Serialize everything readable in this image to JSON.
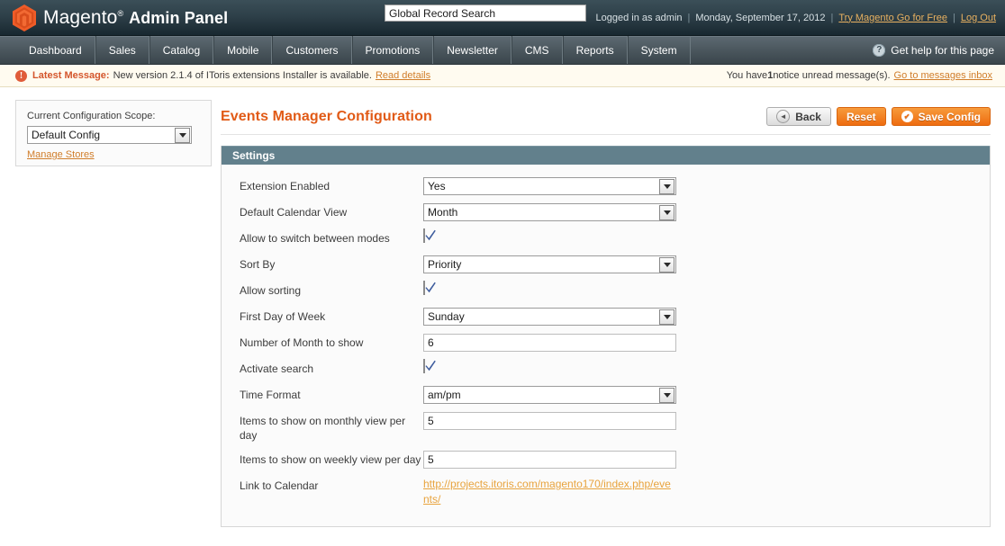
{
  "header": {
    "brand_name": "Magento",
    "brand_tm": "®",
    "brand_suffix": "Admin Panel",
    "search_value": "Global Record Search",
    "search_placeholder": "Global Record Search",
    "logged_in": "Logged in as admin",
    "date": "Monday, September 17, 2012",
    "try_link": "Try Magento Go for Free",
    "logout_link": "Log Out",
    "separator": "|",
    "logo_color": "#ef5c28"
  },
  "nav": {
    "items": [
      {
        "label": "Dashboard",
        "name": "nav-item-dashboard"
      },
      {
        "label": "Sales",
        "name": "nav-item-sales"
      },
      {
        "label": "Catalog",
        "name": "nav-item-catalog"
      },
      {
        "label": "Mobile",
        "name": "nav-item-mobile"
      },
      {
        "label": "Customers",
        "name": "nav-item-customers"
      },
      {
        "label": "Promotions",
        "name": "nav-item-promotions"
      },
      {
        "label": "Newsletter",
        "name": "nav-item-newsletter"
      },
      {
        "label": "CMS",
        "name": "nav-item-cms"
      },
      {
        "label": "Reports",
        "name": "nav-item-reports"
      },
      {
        "label": "System",
        "name": "nav-item-system"
      }
    ],
    "help_label": "Get help for this page",
    "help_icon_glyph": "?"
  },
  "message_bar": {
    "icon_glyph": "!",
    "title": "Latest Message:",
    "text": "New version 2.1.4 of IToris extensions Installer is available.",
    "read_details": "Read details",
    "unread_prefix": "You have ",
    "unread_count": "1",
    "unread_suffix": " notice unread message(s).",
    "inbox_link": "Go to messages inbox"
  },
  "sidebar": {
    "scope_label": "Current Configuration Scope:",
    "scope_value": "Default Config",
    "manage_stores": "Manage Stores"
  },
  "content": {
    "page_title": "Events Manager Configuration",
    "buttons": {
      "back": "Back",
      "reset": "Reset",
      "save": "Save Config",
      "back_icon_glyph": "◄",
      "save_icon_glyph": "✔"
    },
    "panel_title": "Settings",
    "fields": [
      {
        "name": "extension-enabled",
        "label": "Extension Enabled",
        "type": "select",
        "value": "Yes"
      },
      {
        "name": "default-calendar-view",
        "label": "Default Calendar View",
        "type": "select",
        "value": "Month"
      },
      {
        "name": "allow-switch-between-modes",
        "label": "Allow to switch between modes",
        "type": "checkbox",
        "value": "checked"
      },
      {
        "name": "sort-by",
        "label": "Sort By",
        "type": "select",
        "value": "Priority"
      },
      {
        "name": "allow-sorting",
        "label": "Allow sorting",
        "type": "checkbox",
        "value": "checked"
      },
      {
        "name": "first-day-of-week",
        "label": "First Day of Week",
        "type": "select",
        "value": "Sunday"
      },
      {
        "name": "number-of-month-to-show",
        "label": "Number of Month to show",
        "type": "input",
        "value": "6"
      },
      {
        "name": "activate-search",
        "label": "Activate search",
        "type": "checkbox",
        "value": "checked"
      },
      {
        "name": "time-format",
        "label": "Time Format",
        "type": "select",
        "value": "am/pm"
      },
      {
        "name": "items-monthly-view-per-day",
        "label": "Items to show on monthly view per day",
        "type": "input",
        "value": "5"
      },
      {
        "name": "items-weekly-view-per-day",
        "label": "Items to show on weekly view per day",
        "type": "input",
        "value": "5"
      },
      {
        "name": "link-to-calendar",
        "label": "Link to Calendar",
        "type": "link",
        "value": "http://projects.itoris.com/magento170/index.php/events/"
      }
    ]
  }
}
